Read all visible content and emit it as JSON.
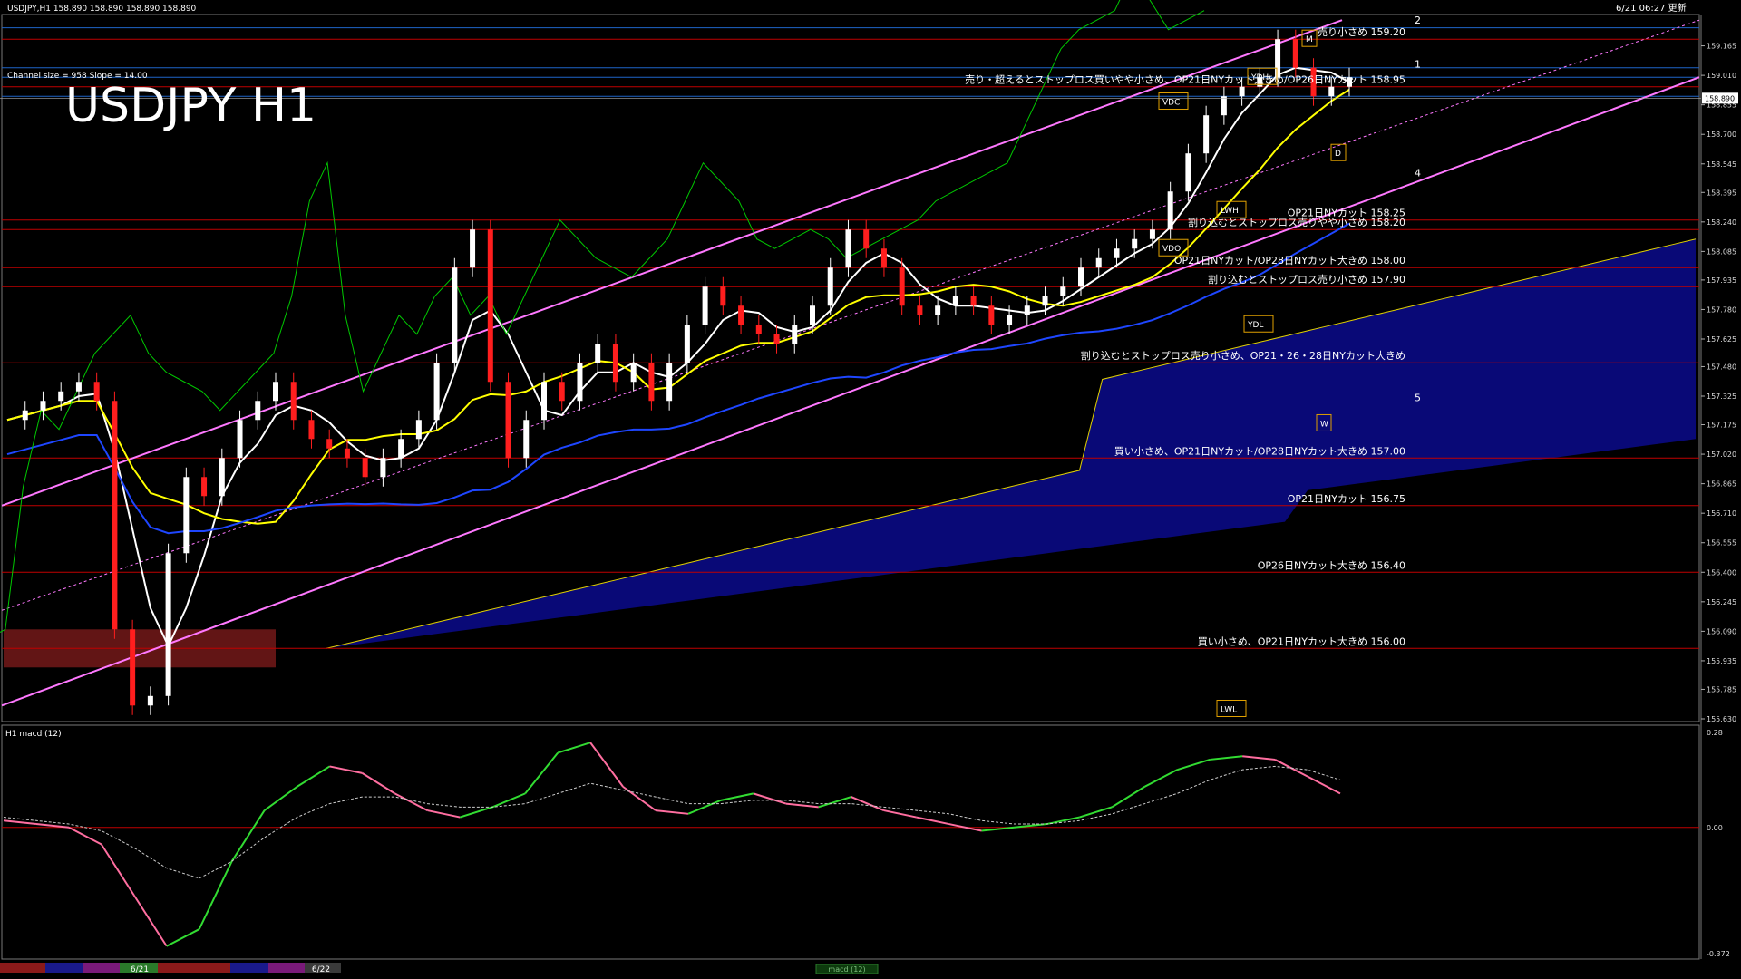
{
  "header": {
    "symbol_info": "USDJPY,H1  158.890 158.890 158.890 158.890",
    "updated": "6/21 06:27 更新",
    "channel_info": "Channel size = 958 Slope = 14.00"
  },
  "big_title": "USDJPY H1",
  "macd_label": "H1  macd (12)",
  "macd_tab": "macd (12)",
  "colors": {
    "background": "#000000",
    "level_line": "#c00000",
    "blue_line": "#1e64c8",
    "channel": "#ff78ff",
    "bull_candle": "#ffffff",
    "bear_candle": "#ff1e1e",
    "ma_white": "#ffffff",
    "ma_yellow": "#ffff00",
    "ma_blue": "#1e46ff",
    "chikou": "#00c800",
    "macd_up": "#32dc32",
    "macd_down": "#ff6ea0",
    "signal": "#cccccc"
  },
  "date_labels": [
    "6/21",
    "6/22"
  ],
  "chart_data": {
    "type": "candlestick",
    "title": "USDJPY H1",
    "price_axis": {
      "range": [
        155.63,
        159.32
      ],
      "ticks": [
        "159.165",
        "159.010",
        "158.855",
        "158.700",
        "158.545",
        "158.395",
        "158.240",
        "158.085",
        "157.935",
        "157.780",
        "157.625",
        "157.480",
        "157.325",
        "157.175",
        "157.020",
        "156.865",
        "156.710",
        "156.555",
        "156.400",
        "156.245",
        "156.090",
        "155.935",
        "155.785",
        "155.630"
      ],
      "current_price": "158.890"
    },
    "close_path": [
      157.2,
      157.25,
      157.3,
      157.35,
      157.4,
      157.3,
      156.1,
      155.7,
      155.75,
      156.5,
      156.9,
      156.8,
      157.0,
      157.2,
      157.3,
      157.4,
      157.2,
      157.1,
      157.05,
      157.0,
      156.9,
      157.0,
      157.1,
      157.2,
      157.5,
      158.0,
      158.2,
      157.4,
      157.0,
      157.2,
      157.4,
      157.3,
      157.5,
      157.6,
      157.4,
      157.5,
      157.3,
      157.5,
      157.7,
      157.9,
      157.8,
      157.7,
      157.65,
      157.6,
      157.7,
      157.8,
      158.0,
      158.2,
      158.1,
      158.0,
      157.8,
      157.75,
      157.8,
      157.85,
      157.8,
      157.7,
      157.75,
      157.8,
      157.85,
      157.9,
      158.0,
      158.05,
      158.1,
      158.15,
      158.2,
      158.4,
      158.6,
      158.8,
      158.9,
      158.95,
      159.0,
      159.2,
      159.05,
      158.9,
      158.95,
      159.0
    ],
    "price_levels": [
      {
        "price": 159.2,
        "label": "売り小さめ 159.20"
      },
      {
        "price": 158.95,
        "label": "売り・超えるとストップロス買いやや小さめ、OP21日NYカット大きめ/OP26日NYカット 158.95"
      },
      {
        "price": 158.25,
        "label": "OP21日NYカット 158.25"
      },
      {
        "price": 158.2,
        "label": "割り込むとストップロス売りやや小さめ 158.20"
      },
      {
        "price": 158.0,
        "label": "OP21日NYカット/OP28日NYカット大きめ 158.00"
      },
      {
        "price": 157.9,
        "label": "割り込むとストップロス売り小さめ 157.90"
      },
      {
        "price": 157.5,
        "label": "割り込むとストップロス売り小さめ、OP21・26・28日NYカット大きめ"
      },
      {
        "price": 157.0,
        "label": "買い小さめ、OP21日NYカット/OP28日NYカット大きめ 157.00"
      },
      {
        "price": 156.75,
        "label": "OP21日NYカット 156.75"
      },
      {
        "price": 156.4,
        "label": "OP26日NYカット大きめ 156.40"
      },
      {
        "price": 156.0,
        "label": "買い小さめ、OP21日NYカット大きめ 156.00"
      }
    ],
    "blue_levels": [
      159.26,
      159.05,
      159.0,
      158.9
    ],
    "box_labels": [
      "VDC",
      "YDH",
      "VDO",
      "YDL",
      "LWH",
      "LWL",
      "W",
      "D",
      "M"
    ],
    "wave_numbers": [
      "1",
      "2",
      "4",
      "5"
    ],
    "macd_axis": {
      "ticks": [
        "0.28",
        "0.00",
        "-0.372"
      ],
      "range": [
        -0.372,
        0.28
      ]
    },
    "macd_values": [
      0.02,
      0.01,
      0.0,
      -0.05,
      -0.2,
      -0.35,
      -0.3,
      -0.1,
      0.05,
      0.12,
      0.18,
      0.16,
      0.1,
      0.05,
      0.03,
      0.06,
      0.1,
      0.22,
      0.25,
      0.12,
      0.05,
      0.04,
      0.08,
      0.1,
      0.07,
      0.06,
      0.09,
      0.05,
      0.03,
      0.01,
      -0.01,
      0.0,
      0.01,
      0.03,
      0.06,
      0.12,
      0.17,
      0.2,
      0.21,
      0.2,
      0.15,
      0.1
    ],
    "signal_values": [
      0.03,
      0.02,
      0.01,
      -0.01,
      -0.06,
      -0.12,
      -0.15,
      -0.1,
      -0.03,
      0.03,
      0.07,
      0.09,
      0.09,
      0.07,
      0.06,
      0.06,
      0.07,
      0.1,
      0.13,
      0.11,
      0.09,
      0.07,
      0.07,
      0.08,
      0.08,
      0.07,
      0.07,
      0.06,
      0.05,
      0.04,
      0.02,
      0.01,
      0.01,
      0.02,
      0.04,
      0.07,
      0.1,
      0.14,
      0.17,
      0.18,
      0.17,
      0.14
    ]
  }
}
